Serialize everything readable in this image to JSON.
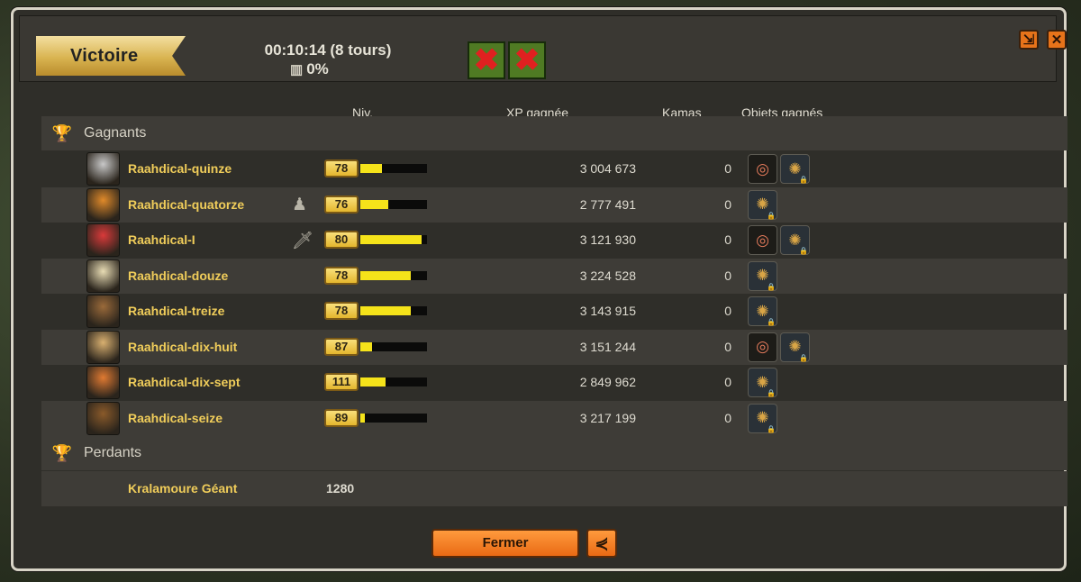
{
  "header": {
    "result_label": "Victoire",
    "fight_time": "00:10:14 (8 tours)",
    "loot_percent": "0%",
    "chest_icon": "chest-icon",
    "challenges": [
      {
        "icon": "challenge-failed-icon",
        "symbol": "✖"
      },
      {
        "icon": "challenge-failed-icon",
        "symbol": "✖"
      }
    ],
    "window_controls": [
      {
        "icon": "minimize-icon",
        "symbol": "⇲"
      },
      {
        "icon": "close-icon",
        "symbol": "✕"
      }
    ]
  },
  "columns": {
    "level": "Niv.",
    "xp": "XP gagnée",
    "kamas": "Kamas",
    "items": "Objets gagnés"
  },
  "winners": {
    "title": "Gagnants",
    "icon": "trophy-icon",
    "players": [
      {
        "name": "Raahdical-quinze",
        "level": "78",
        "level_progress": 0.32,
        "xp": "3 004 673",
        "kamas": "0",
        "role": "",
        "avatar_color": "#c8c8c8",
        "items": [
          "donut",
          "relic"
        ]
      },
      {
        "name": "Raahdical-quatorze",
        "level": "76",
        "level_progress": 0.42,
        "xp": "2 777 491",
        "kamas": "0",
        "role": "♟",
        "avatar_color": "#e08a2a",
        "items": [
          "relic"
        ]
      },
      {
        "name": "Raahdical-I",
        "level": "80",
        "level_progress": 0.92,
        "xp": "3 121 930",
        "kamas": "0",
        "role": "🗡",
        "avatar_color": "#d93a3a",
        "items": [
          "donut",
          "relic"
        ]
      },
      {
        "name": "Raahdical-douze",
        "level": "78",
        "level_progress": 0.76,
        "xp": "3 224 528",
        "kamas": "0",
        "role": "",
        "avatar_color": "#e8dcb4",
        "items": [
          "relic"
        ]
      },
      {
        "name": "Raahdical-treize",
        "level": "78",
        "level_progress": 0.76,
        "xp": "3 143 915",
        "kamas": "0",
        "role": "",
        "avatar_color": "#9a6a3a",
        "items": [
          "relic"
        ]
      },
      {
        "name": "Raahdical-dix-huit",
        "level": "87",
        "level_progress": 0.18,
        "xp": "3 151 244",
        "kamas": "0",
        "role": "",
        "avatar_color": "#d9b070",
        "items": [
          "donut",
          "relic"
        ]
      },
      {
        "name": "Raahdical-dix-sept",
        "level": "111",
        "level_progress": 0.38,
        "xp": "2 849 962",
        "kamas": "0",
        "role": "",
        "avatar_color": "#e07a32",
        "items": [
          "relic"
        ]
      },
      {
        "name": "Raahdical-seize",
        "level": "89",
        "level_progress": 0.07,
        "xp": "3 217 199",
        "kamas": "0",
        "role": "",
        "avatar_color": "#8a5a2a",
        "items": [
          "relic"
        ]
      }
    ]
  },
  "losers": {
    "title": "Perdants",
    "icon": "broken-trophy-icon",
    "monsters": [
      {
        "name": "Kralamoure Géant",
        "level": "1280"
      }
    ]
  },
  "footer": {
    "close_label": "Fermer",
    "share_icon": "share-icon"
  },
  "colors": {
    "accent": "#e96a14",
    "player_name": "#f0cd5a",
    "xp_bar": "#f5e31a",
    "banner_gold": "#d9b451",
    "challenge_bg": "#4f7a23",
    "challenge_failed": "#e02020"
  }
}
